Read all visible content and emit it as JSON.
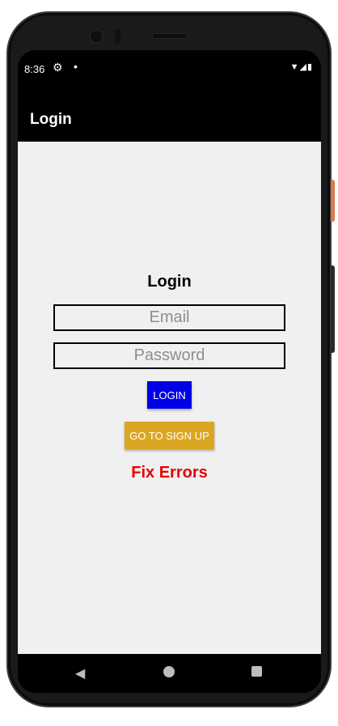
{
  "status_bar": {
    "time": "8:36",
    "icons": {
      "settings": "gear-icon",
      "notification_dot": "•",
      "signal": "▼◢▮"
    }
  },
  "app_bar": {
    "title": "Login"
  },
  "form": {
    "heading": "Login",
    "email": {
      "placeholder": "Email",
      "value": ""
    },
    "password": {
      "placeholder": "Password",
      "value": ""
    },
    "login_button": "LOGIN",
    "signup_button": "GO TO SIGN UP",
    "error_message": "Fix Errors"
  },
  "nav_bar": {
    "back": "◀"
  },
  "colors": {
    "login_button": "#0000e6",
    "signup_button": "#dba621",
    "error_text": "#e60000",
    "background": "#f0f0f0",
    "app_bar": "#000000"
  }
}
